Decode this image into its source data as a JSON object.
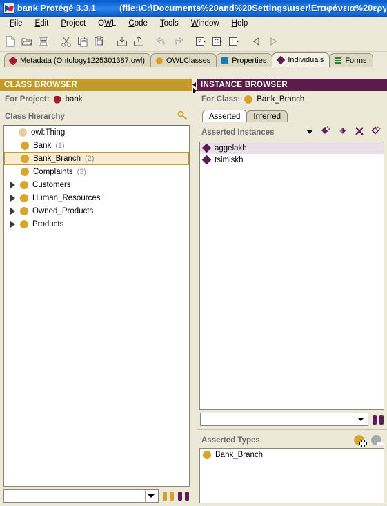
{
  "window": {
    "app_title": "bank  Protégé 3.3.1",
    "file_path": "(file:\\C:\\Documents%20and%20Settings\\user\\Επιφάνεια%20εργα",
    "icon": "protege-app-icon"
  },
  "menubar": {
    "items": [
      {
        "label": "File",
        "mnemonic": "F"
      },
      {
        "label": "Edit",
        "mnemonic": "E"
      },
      {
        "label": "Project",
        "mnemonic": "P"
      },
      {
        "label": "OWL",
        "mnemonic": "W"
      },
      {
        "label": "Code",
        "mnemonic": "C"
      },
      {
        "label": "Tools",
        "mnemonic": "T"
      },
      {
        "label": "Window",
        "mnemonic": "W"
      },
      {
        "label": "Help",
        "mnemonic": "H"
      }
    ]
  },
  "toolbar": {
    "buttons": [
      {
        "name": "new-project-icon",
        "title": "New Project"
      },
      {
        "name": "open-project-icon",
        "title": "Open Project"
      },
      {
        "name": "save-project-icon",
        "title": "Save Project"
      },
      {
        "name": "cut-icon",
        "title": "Cut"
      },
      {
        "name": "copy-icon",
        "title": "Copy"
      },
      {
        "name": "paste-icon",
        "title": "Paste"
      },
      {
        "name": "import-icon",
        "title": "Import"
      },
      {
        "name": "export-icon",
        "title": "Export"
      },
      {
        "name": "undo-icon",
        "title": "Undo"
      },
      {
        "name": "redo-icon",
        "title": "Redo"
      },
      {
        "name": "query-icon",
        "title": "Queries"
      },
      {
        "name": "class-wizard-icon",
        "title": "Classes"
      },
      {
        "name": "instance-wizard-icon",
        "title": "Instances"
      },
      {
        "name": "back-icon",
        "title": "Back"
      },
      {
        "name": "forward-icon",
        "title": "Forward"
      }
    ]
  },
  "tabs": [
    {
      "label": "Metadata (Ontology1225301387.owl)",
      "icon": "metadata-icon",
      "active": false
    },
    {
      "label": "OWLClasses",
      "icon": "owl-classes-icon",
      "active": false
    },
    {
      "label": "Properties",
      "icon": "properties-icon",
      "active": false
    },
    {
      "label": "Individuals",
      "icon": "individuals-icon",
      "active": true
    },
    {
      "label": "Forms",
      "icon": "forms-icon",
      "active": false
    }
  ],
  "class_browser": {
    "header": "CLASS BROWSER",
    "for_label": "For Project:",
    "project_name": "bank",
    "hierarchy_label": "Class Hierarchy",
    "search_icon": "find-class-icon",
    "nodes": [
      {
        "label": "owl:Thing",
        "count": "",
        "indent": 0,
        "expandable": false,
        "selected": false,
        "root": true
      },
      {
        "label": "Bank",
        "count": "(1)",
        "indent": 1,
        "expandable": false,
        "selected": false
      },
      {
        "label": "Bank_Branch",
        "count": "(2)",
        "indent": 1,
        "expandable": false,
        "selected": true
      },
      {
        "label": "Complaints",
        "count": "(3)",
        "indent": 1,
        "expandable": false,
        "selected": false
      },
      {
        "label": "Customers",
        "count": "",
        "indent": 1,
        "expandable": true,
        "selected": false
      },
      {
        "label": "Human_Resources",
        "count": "",
        "indent": 1,
        "expandable": true,
        "selected": false
      },
      {
        "label": "Owned_Products",
        "count": "",
        "indent": 1,
        "expandable": true,
        "selected": false
      },
      {
        "label": "Products",
        "count": "",
        "indent": 1,
        "expandable": true,
        "selected": false
      }
    ],
    "search": {
      "value": "",
      "placeholder": ""
    }
  },
  "instance_browser": {
    "header": "INSTANCE BROWSER",
    "for_label": "For Class:",
    "class_name": "Bank_Branch",
    "subtabs": [
      {
        "label": "Asserted",
        "active": true
      },
      {
        "label": "Inferred",
        "active": false
      }
    ],
    "list_title": "Asserted Instances",
    "actions": [
      {
        "name": "instances-menu-icon",
        "title": "Display options"
      },
      {
        "name": "create-instance-icon",
        "title": "Create instance"
      },
      {
        "name": "create-subinstance-icon",
        "title": "Create instance of subclass"
      },
      {
        "name": "remove-instance-icon",
        "title": "Remove instance"
      },
      {
        "name": "duplicate-instance-icon",
        "title": "Duplicate instance"
      }
    ],
    "instances": [
      {
        "label": "aggelakh",
        "selected": true
      },
      {
        "label": "tsimiskh",
        "selected": false
      }
    ],
    "search": {
      "value": "",
      "placeholder": ""
    }
  },
  "asserted_types": {
    "title": "Asserted Types",
    "add_icon": "add-type-icon",
    "remove_icon": "remove-type-icon",
    "items": [
      {
        "label": "Bank_Branch"
      }
    ]
  },
  "colors": {
    "class_browser_header": "#c49a2a",
    "instance_browser_header": "#5a1c4a",
    "titlebar": "#0a5ccc",
    "panel_background": "#ece9d8",
    "selection_gold": "#f7ecd3",
    "selection_lavender": "#e8dfe8"
  }
}
